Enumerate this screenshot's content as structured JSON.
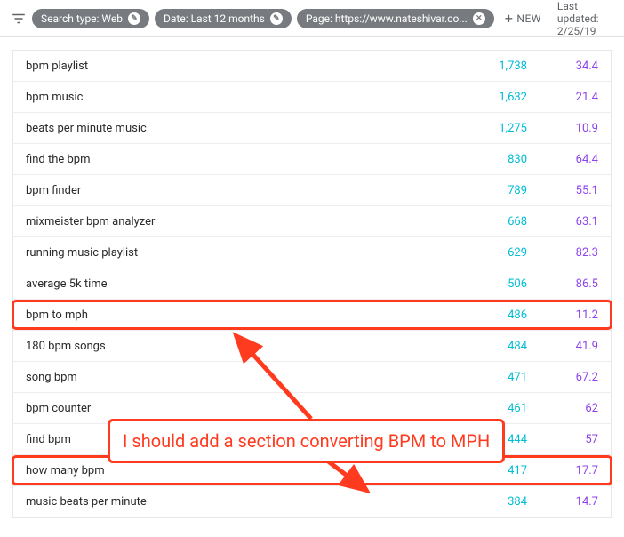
{
  "filters": {
    "search_type": "Search type: Web",
    "date": "Date: Last 12 months",
    "page": "Page: https://www.nateshivar.co...",
    "new_label": "NEW"
  },
  "last_updated": "Last updated: 2/25/19",
  "rows": [
    {
      "query": "bpm playlist",
      "n": "1,738",
      "p": "34.4"
    },
    {
      "query": "bpm music",
      "n": "1,632",
      "p": "21.4"
    },
    {
      "query": "beats per minute music",
      "n": "1,275",
      "p": "10.9"
    },
    {
      "query": "find the bpm",
      "n": "830",
      "p": "64.4"
    },
    {
      "query": "bpm finder",
      "n": "789",
      "p": "55.1"
    },
    {
      "query": "mixmeister bpm analyzer",
      "n": "668",
      "p": "63.1"
    },
    {
      "query": "running music playlist",
      "n": "629",
      "p": "82.3"
    },
    {
      "query": "average 5k time",
      "n": "506",
      "p": "86.5"
    },
    {
      "query": "bpm to mph",
      "n": "486",
      "p": "11.2"
    },
    {
      "query": "180 bpm songs",
      "n": "484",
      "p": "41.9"
    },
    {
      "query": "song bpm",
      "n": "471",
      "p": "67.2"
    },
    {
      "query": "bpm counter",
      "n": "461",
      "p": "62"
    },
    {
      "query": "find bpm",
      "n": "444",
      "p": "57"
    },
    {
      "query": "how many bpm",
      "n": "417",
      "p": "17.7"
    },
    {
      "query": "music beats per minute",
      "n": "384",
      "p": "14.7"
    }
  ],
  "annotation": "I should add a section converting BPM to MPH"
}
